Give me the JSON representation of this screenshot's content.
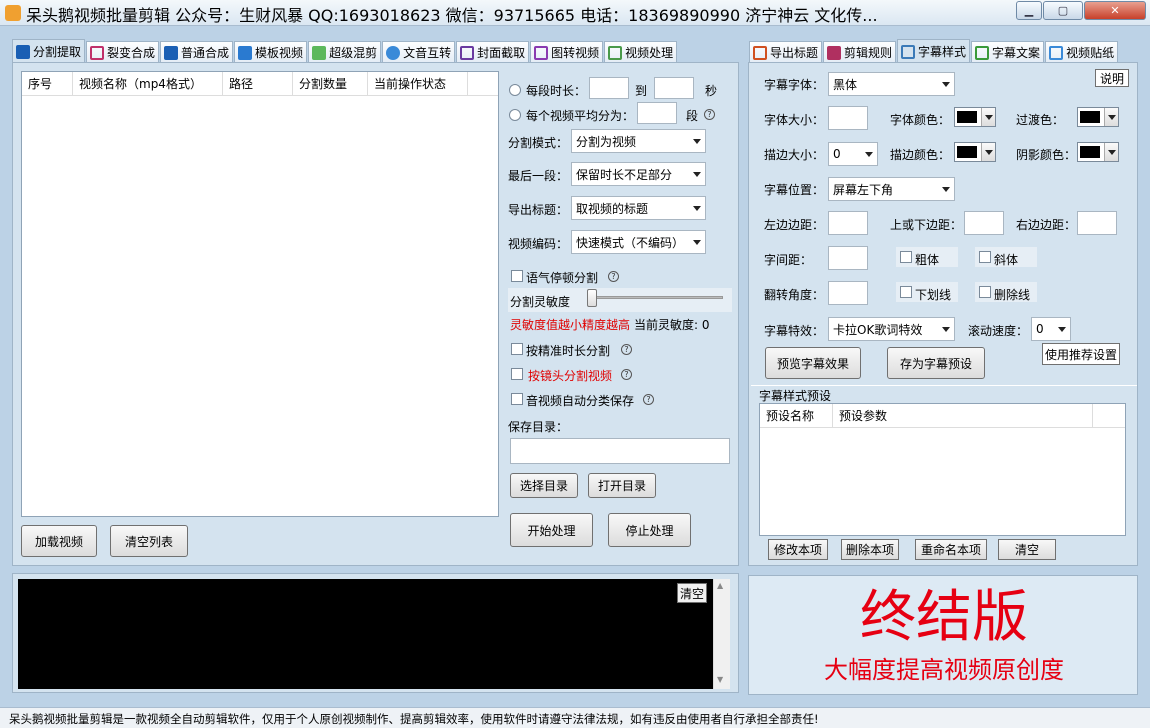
{
  "window": {
    "title": "呆头鹅视频批量剪辑 公众号：生财风暴 QQ:1693018623 微信：93715665 电话：18369890990 济宁神云 文化传..."
  },
  "left_tabs": [
    "分割提取",
    "裂变合成",
    "普通合成",
    "模板视频",
    "超级混剪",
    "文音互转",
    "封面截取",
    "图转视频",
    "视频处理"
  ],
  "right_tabs": [
    "导出标题",
    "剪辑规则",
    "字幕样式",
    "字幕文案",
    "视频贴纸"
  ],
  "table": {
    "columns": [
      "序号",
      "视频名称（mp4格式）",
      "路径",
      "分割数量",
      "当前操作状态"
    ]
  },
  "left_buttons": {
    "load": "加载视频",
    "clear": "清空列表"
  },
  "split": {
    "each_len": "每段时长：",
    "to": "到",
    "sec": "秒",
    "avg": "每个视频平均分为：",
    "seg": "段",
    "mode_label": "分割模式：",
    "mode_value": "分割为视频",
    "last_label": "最后一段：",
    "last_value": "保留时长不足部分",
    "title_label": "导出标题：",
    "title_value": "取视频的标题",
    "codec_label": "视频编码：",
    "codec_value": "快速模式（不编码）",
    "pause_split": "语气停顿分割",
    "sensitivity": "分割灵敏度",
    "sens_note": "灵敏度值越小精度越高",
    "current_sens": "当前灵敏度: 0",
    "precise": "按精准时长分割",
    "shot": "按镜头分割视频",
    "auto_cat": "音视频自动分类保存",
    "save_dir": "保存目录：",
    "choose_dir": "选择目录",
    "open_dir": "打开目录",
    "start": "开始处理",
    "stop": "停止处理"
  },
  "log": {
    "clear": "清空"
  },
  "subtitle": {
    "font_label": "字幕字体：",
    "font_value": "黑体",
    "explain": "说明",
    "size_label": "字体大小：",
    "color_label": "字体颜色：",
    "trans_label": "过渡色：",
    "stroke_label": "描边大小：",
    "stroke_value": "0",
    "stroke_color_label": "描边颜色：",
    "shadow_label": "阴影颜色：",
    "pos_label": "字幕位置：",
    "pos_value": "屏幕左下角",
    "left_margin": "左边边距：",
    "tb_margin": "上或下边距：",
    "right_margin": "右边边距：",
    "spacing": "字间距：",
    "bold": "粗体",
    "italic": "斜体",
    "rotate": "翻转角度：",
    "underline": "下划线",
    "strike": "删除线",
    "effect_label": "字幕特效：",
    "effect_value": "卡拉OK歌词特效",
    "scroll_label": "滚动速度：",
    "scroll_value": "0",
    "preview": "预览字幕效果",
    "save_preset": "存为字幕预设",
    "recommend": "使用推荐设置"
  },
  "presets": {
    "title": "字幕样式预设",
    "columns": [
      "预设名称",
      "预设参数"
    ],
    "modify": "修改本项",
    "delete": "删除本项",
    "rename": "重命名本项",
    "clear": "清空"
  },
  "promo": {
    "big": "终结版",
    "sub": "大幅度提高视频原创度",
    "color": "#e60012"
  },
  "status": "呆头鹅视频批量剪辑是一款视频全自动剪辑软件，仅用于个人原创视频制作、提高剪辑效率，使用软件时请遵守法律法规，如有违反由使用者自行承担全部责任!"
}
